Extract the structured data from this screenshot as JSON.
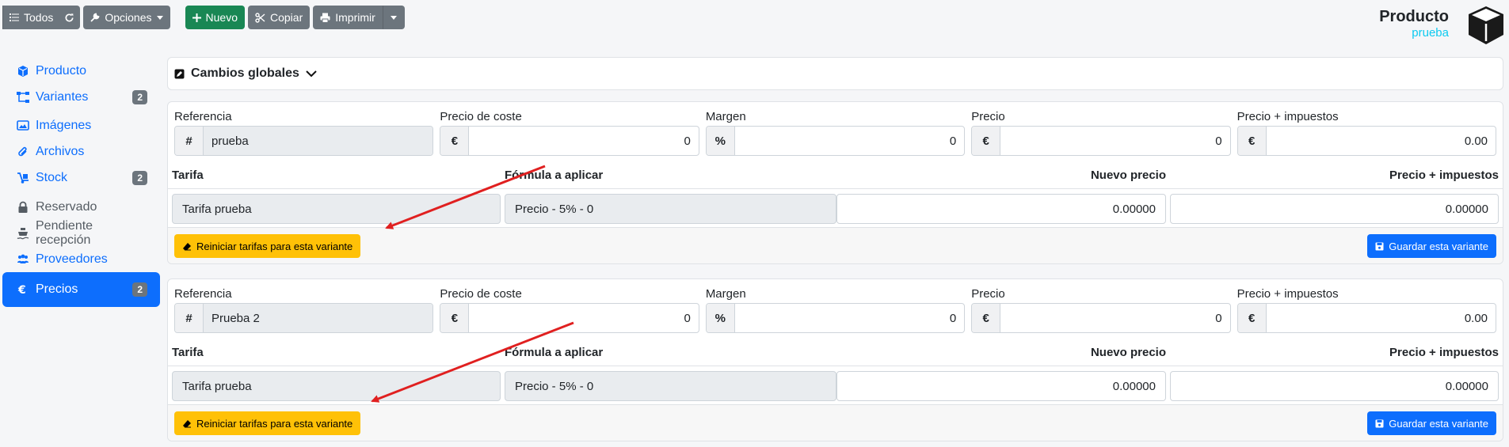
{
  "toolbar": {
    "all_label": "Todos",
    "options_label": "Opciones",
    "new_label": "Nuevo",
    "copy_label": "Copiar",
    "print_label": "Imprimir"
  },
  "header": {
    "title": "Producto",
    "subtitle": "prueba"
  },
  "sidebar": {
    "items": [
      {
        "label": "Producto",
        "icon": "cube-icon"
      },
      {
        "label": "Variantes",
        "badge": "2",
        "icon": "sitemap-icon"
      },
      {
        "label": "Imágenes",
        "icon": "images-icon"
      },
      {
        "label": "Archivos",
        "icon": "paperclip-icon"
      },
      {
        "label": "Stock",
        "badge": "2",
        "icon": "dolly-icon"
      },
      {
        "label": "Reservado",
        "icon": "lock-icon"
      },
      {
        "label": "Pendiente recepción",
        "icon": "ship-icon"
      },
      {
        "label": "Proveedores",
        "icon": "users-icon"
      },
      {
        "label": "Precios",
        "badge": "2",
        "icon": "euro-icon"
      }
    ]
  },
  "global_changes": {
    "label": "Cambios globales"
  },
  "field_labels": {
    "reference": "Referencia",
    "cost_price": "Precio de coste",
    "margin": "Margen",
    "price": "Precio",
    "price_tax": "Precio + impuestos"
  },
  "field_prefixes": {
    "reference": "#",
    "cost_price": "€",
    "margin": "%",
    "price": "€",
    "price_tax": "€"
  },
  "table_headers": {
    "rate": "Tarifa",
    "formula": "Fórmula a aplicar",
    "new_price": "Nuevo precio",
    "price_tax": "Precio + impuestos"
  },
  "variants": [
    {
      "reference": "prueba",
      "cost_price": "0",
      "margin": "0",
      "price": "0",
      "price_tax": "0.00",
      "rate": {
        "name": "Tarifa prueba",
        "formula": "Precio - 5% - 0",
        "new_price": "0.00000",
        "price_tax": "0.00000"
      },
      "reset_label": "Reiniciar tarifas para esta variante",
      "save_label": "Guardar esta variante"
    },
    {
      "reference": "Prueba 2",
      "cost_price": "0",
      "margin": "0",
      "price": "0",
      "price_tax": "0.00",
      "rate": {
        "name": "Tarifa prueba",
        "formula": "Precio - 5% - 0",
        "new_price": "0.00000",
        "price_tax": "0.00000"
      },
      "reset_label": "Reiniciar tarifas para esta variante",
      "save_label": "Guardar esta variante"
    }
  ],
  "colors": {
    "primary": "#0d6efd",
    "warning": "#ffc107",
    "success": "#198754",
    "secondary": "#6c757d",
    "annotation": "#e02020"
  }
}
